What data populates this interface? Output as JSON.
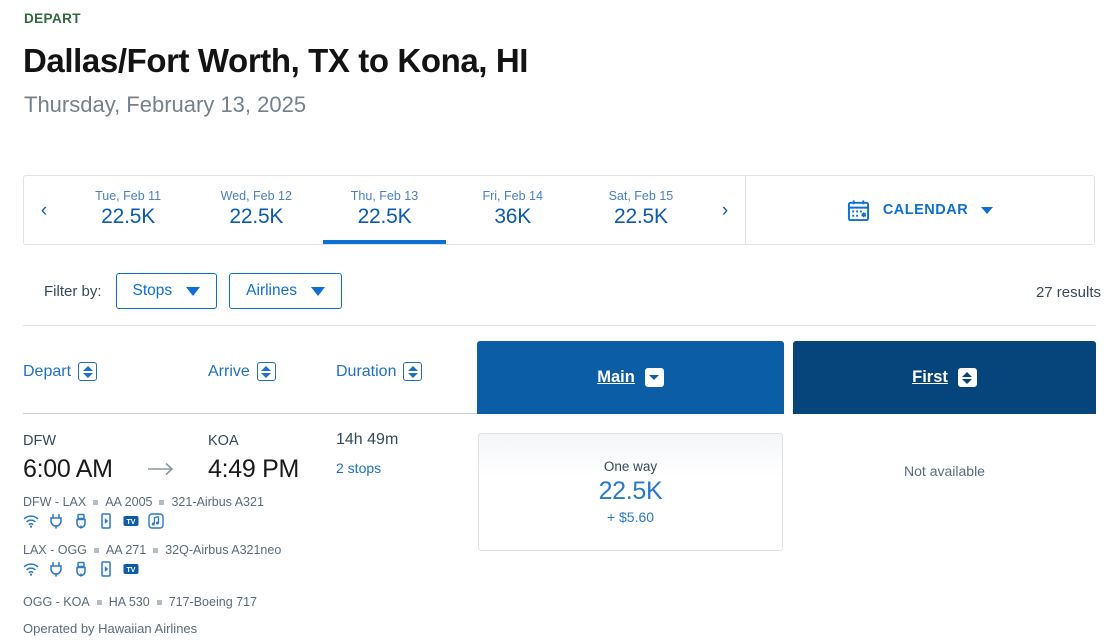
{
  "header": {
    "depart_label": "DEPART",
    "route_title": "Dallas/Fort Worth, TX to Kona, HI",
    "route_date": "Thursday, February 13, 2025"
  },
  "carousel": {
    "prev_icon": "chevron-left-icon",
    "next_icon": "chevron-right-icon",
    "prev_glyph": "‹",
    "next_glyph": "›",
    "dates": [
      {
        "day": "Tue, Feb 11",
        "price": "22.5K",
        "active": false
      },
      {
        "day": "Wed, Feb 12",
        "price": "22.5K",
        "active": false
      },
      {
        "day": "Thu, Feb 13",
        "price": "22.5K",
        "active": true
      },
      {
        "day": "Fri, Feb 14",
        "price": "36K",
        "active": false
      },
      {
        "day": "Sat, Feb 15",
        "price": "22.5K",
        "active": false
      }
    ],
    "calendar_label": "CALENDAR",
    "calendar_icon": "calendar-icon"
  },
  "filters": {
    "label": "Filter by:",
    "buttons": [
      {
        "label": "Stops"
      },
      {
        "label": "Airlines"
      }
    ],
    "results": "27 results"
  },
  "columns": {
    "depart": "Depart",
    "arrive": "Arrive",
    "duration": "Duration"
  },
  "fare_tabs": [
    {
      "label": "Main",
      "color": "#0b5ea5",
      "sort": "down"
    },
    {
      "label": "First",
      "color": "#06447c",
      "sort": "updown"
    }
  ],
  "flight": {
    "depart_code": "DFW",
    "depart_time": "6:00 AM",
    "arrive_code": "KOA",
    "arrive_time": "4:49 PM",
    "duration": "14h 49m",
    "stops": "2 stops",
    "segments": [
      {
        "route": "DFW - LAX",
        "flight_number": "AA 2005",
        "aircraft": "321-Airbus A321",
        "amenities": [
          "wifi-icon",
          "power-outlet-icon",
          "usb-port-icon",
          "device-icon",
          "tv-icon",
          "music-icon"
        ]
      },
      {
        "route": "LAX - OGG",
        "flight_number": "AA 271",
        "aircraft": "32Q-Airbus A321neo",
        "amenities": [
          "wifi-icon",
          "power-outlet-icon",
          "usb-port-icon",
          "device-icon",
          "tv-icon"
        ]
      },
      {
        "route": "OGG - KOA",
        "flight_number": "HA 530",
        "aircraft": "717-Boeing 717",
        "amenities": []
      }
    ],
    "operated_by": "Operated by Hawaiian Airlines",
    "main_fare": {
      "type": "One way",
      "miles": "22.5K",
      "fees": "+ $5.60"
    },
    "first_fare": {
      "status": "Not available"
    }
  },
  "colors": {
    "accent_blue": "#0d6fd1",
    "link_blue": "#1f6fc4",
    "main_tab": "#0b5ea5",
    "first_tab": "#06447c",
    "depart_green": "#2e6a3b"
  }
}
